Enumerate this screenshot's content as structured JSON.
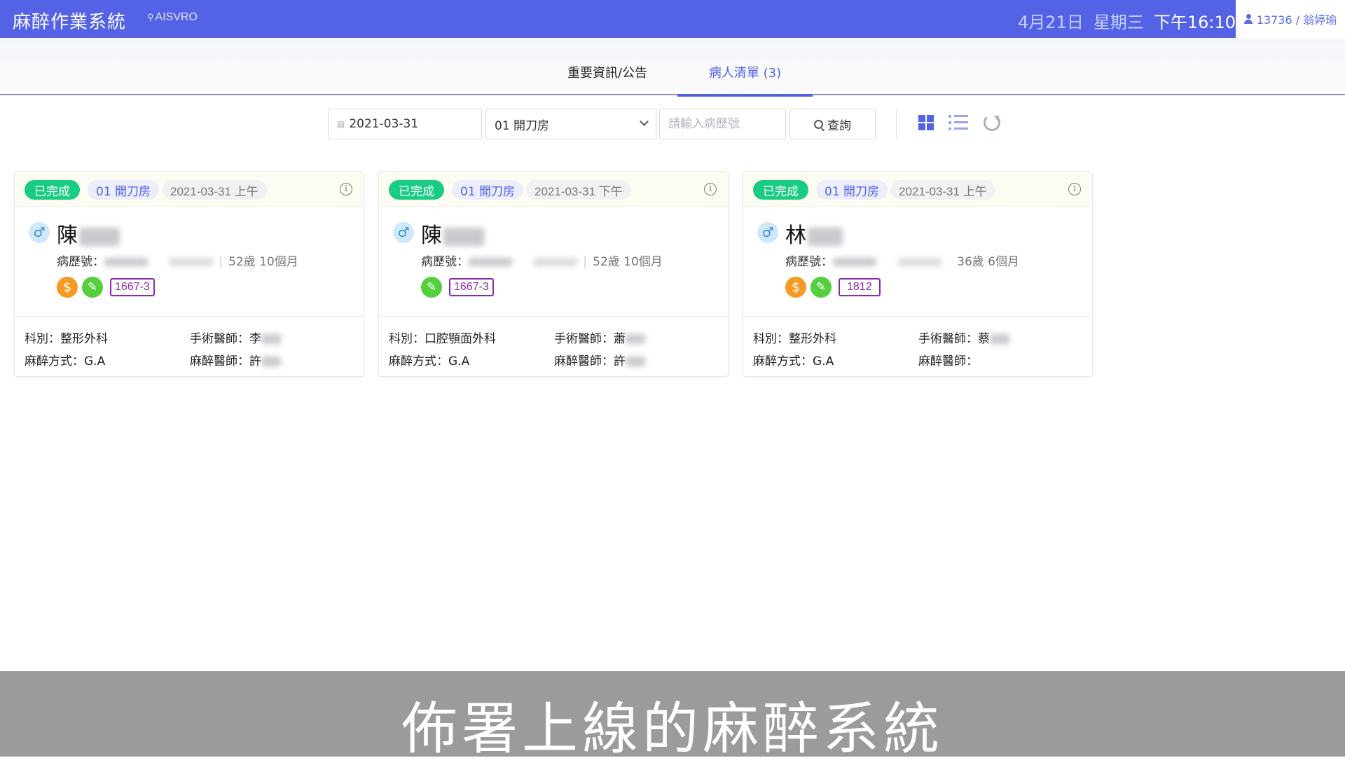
{
  "header": {
    "app_title": "麻醉作業系統",
    "location": "AISVRO",
    "date": "4月21日",
    "weekday": "星期三",
    "time": "下午16:10",
    "user": "13736 / 翁婷瑜",
    "bg_color": "#5463E6"
  },
  "tabs": [
    {
      "label": "重要資訊/公告",
      "active": false
    },
    {
      "label": "病人清單 (3)",
      "active": true
    }
  ],
  "toolbar": {
    "date_value": "2021-03-31",
    "room_value": "01 開刀房",
    "record_placeholder": "請輸入病歷號",
    "search_label": "查詢",
    "view_icons": [
      "grid-view-icon",
      "list-view-icon",
      "refresh-icon"
    ]
  },
  "patients": [
    {
      "status": "已完成",
      "room": "01 開刀房",
      "datetime": "2021-03-31 上午",
      "surname": "陳",
      "record_label": "病歷號：",
      "age": "52歲 10個月",
      "code": "1667-3",
      "has_fee": true,
      "department": "科別：整形外科",
      "surgeon": "手術醫師：李",
      "anesthesia_method": "麻醉方式：G.A",
      "anesthesiologist": "麻醉醫師：許"
    },
    {
      "status": "已完成",
      "room": "01 開刀房",
      "datetime": "2021-03-31 下午",
      "surname": "陳",
      "record_label": "病歷號：",
      "age": "52歲 10個月",
      "code": "1667-3",
      "has_fee": false,
      "department": "科別：口腔顎面外科",
      "surgeon": "手術醫師：蕭",
      "anesthesia_method": "麻醉方式：G.A",
      "anesthesiologist": "麻醉醫師：許"
    },
    {
      "status": "已完成",
      "room": "01 開刀房",
      "datetime": "2021-03-31 上午",
      "surname": "林",
      "record_label": "病歷號：",
      "age": "36歲 6個月",
      "code": "1812",
      "has_fee": true,
      "department": "科別：整形外科",
      "surgeon": "手術醫師：蔡",
      "anesthesia_method": "麻醉方式：G.A",
      "anesthesiologist": "麻醉醫師："
    }
  ],
  "caption": "佈署上線的麻醉系統",
  "colors": {
    "status_green": "#19cc84",
    "fee_orange": "#f59b24",
    "pen_green": "#55cf3e",
    "code_purple": "#8a2ba8"
  }
}
